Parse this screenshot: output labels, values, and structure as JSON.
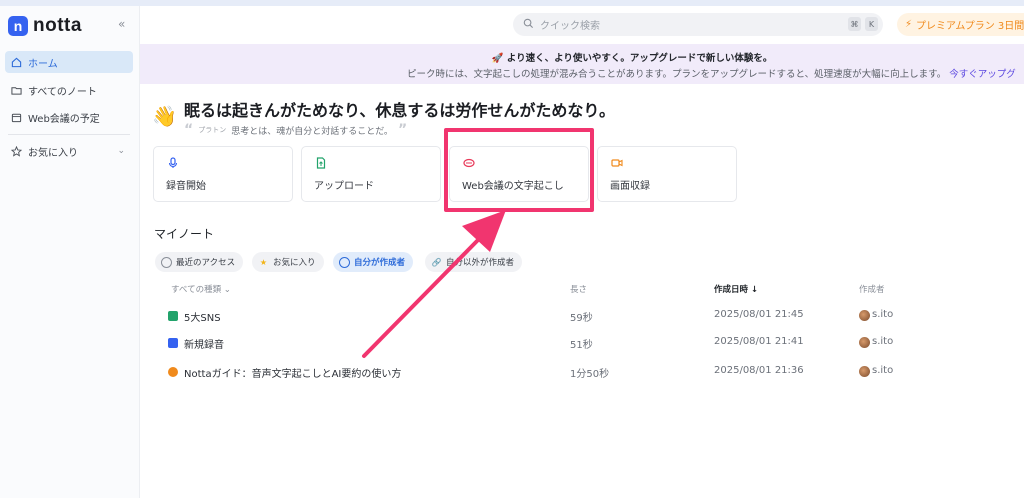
{
  "app": {
    "name": "notta"
  },
  "colors": {
    "accent": "#2d6bd9",
    "highlight": "#f1356f",
    "premium": "#f08a1c",
    "banner_bg": "#f1ebfa"
  },
  "sidebar": {
    "collapse_icon": "double-chevron-left-icon",
    "items": [
      {
        "label": "ホーム",
        "icon": "home-icon",
        "active": true
      },
      {
        "label": "すべてのノート",
        "icon": "folder-icon",
        "active": false
      },
      {
        "label": "Web会議の予定",
        "icon": "calendar-icon",
        "active": false
      },
      {
        "label": "お気に入り",
        "icon": "star-icon",
        "active": false
      }
    ]
  },
  "header": {
    "search_placeholder": "クイック検索",
    "shortcut_keys": [
      "⌘",
      "K"
    ],
    "premium_label": "プレミアムプラン 3日間"
  },
  "banner": {
    "title": "より速く、より使いやすく。アップグレードで新しい体験を。",
    "subtitle": "ピーク時には、文字起こしの処理が混み合うことがあります。プランをアップグレードすると、処理速度が大幅に向上します。",
    "link": "今すぐアップグ"
  },
  "quote": {
    "title": "眠るは起きんがためなり、休息するは労作せんがためなり。",
    "author": "プラトン",
    "text": "思考とは、魂が自分と対話することだ。"
  },
  "actions": [
    {
      "label": "録音開始",
      "icon": "microphone-icon"
    },
    {
      "label": "アップロード",
      "icon": "upload-icon"
    },
    {
      "label": "Web会議の文字起こし",
      "icon": "meeting-icon"
    },
    {
      "label": "画面収録",
      "icon": "screen-record-icon"
    }
  ],
  "notes": {
    "title": "マイノート",
    "filters": [
      {
        "label": "最近のアクセス",
        "active": false
      },
      {
        "label": "お気に入り",
        "active": false
      },
      {
        "label": "自分が作成者",
        "active": true
      },
      {
        "label": "自分以外が作成者",
        "active": false
      }
    ],
    "columns": {
      "type": "すべての種類",
      "length": "長さ",
      "created": "作成日時",
      "creator": "作成者"
    },
    "rows": [
      {
        "title": "5大SNS",
        "length": "59秒",
        "created": "2025/08/01 21:45",
        "creator": "s.ito",
        "icon": "uploaded-file-icon"
      },
      {
        "title": "新規録音",
        "length": "51秒",
        "created": "2025/08/01 21:41",
        "creator": "s.ito",
        "icon": "recording-file-icon"
      },
      {
        "title": "Nottaガイド：音声文字起こしとAI要約の使い方",
        "length": "1分50秒",
        "created": "2025/08/01 21:36",
        "creator": "s.ito",
        "icon": "guide-file-icon"
      }
    ]
  }
}
